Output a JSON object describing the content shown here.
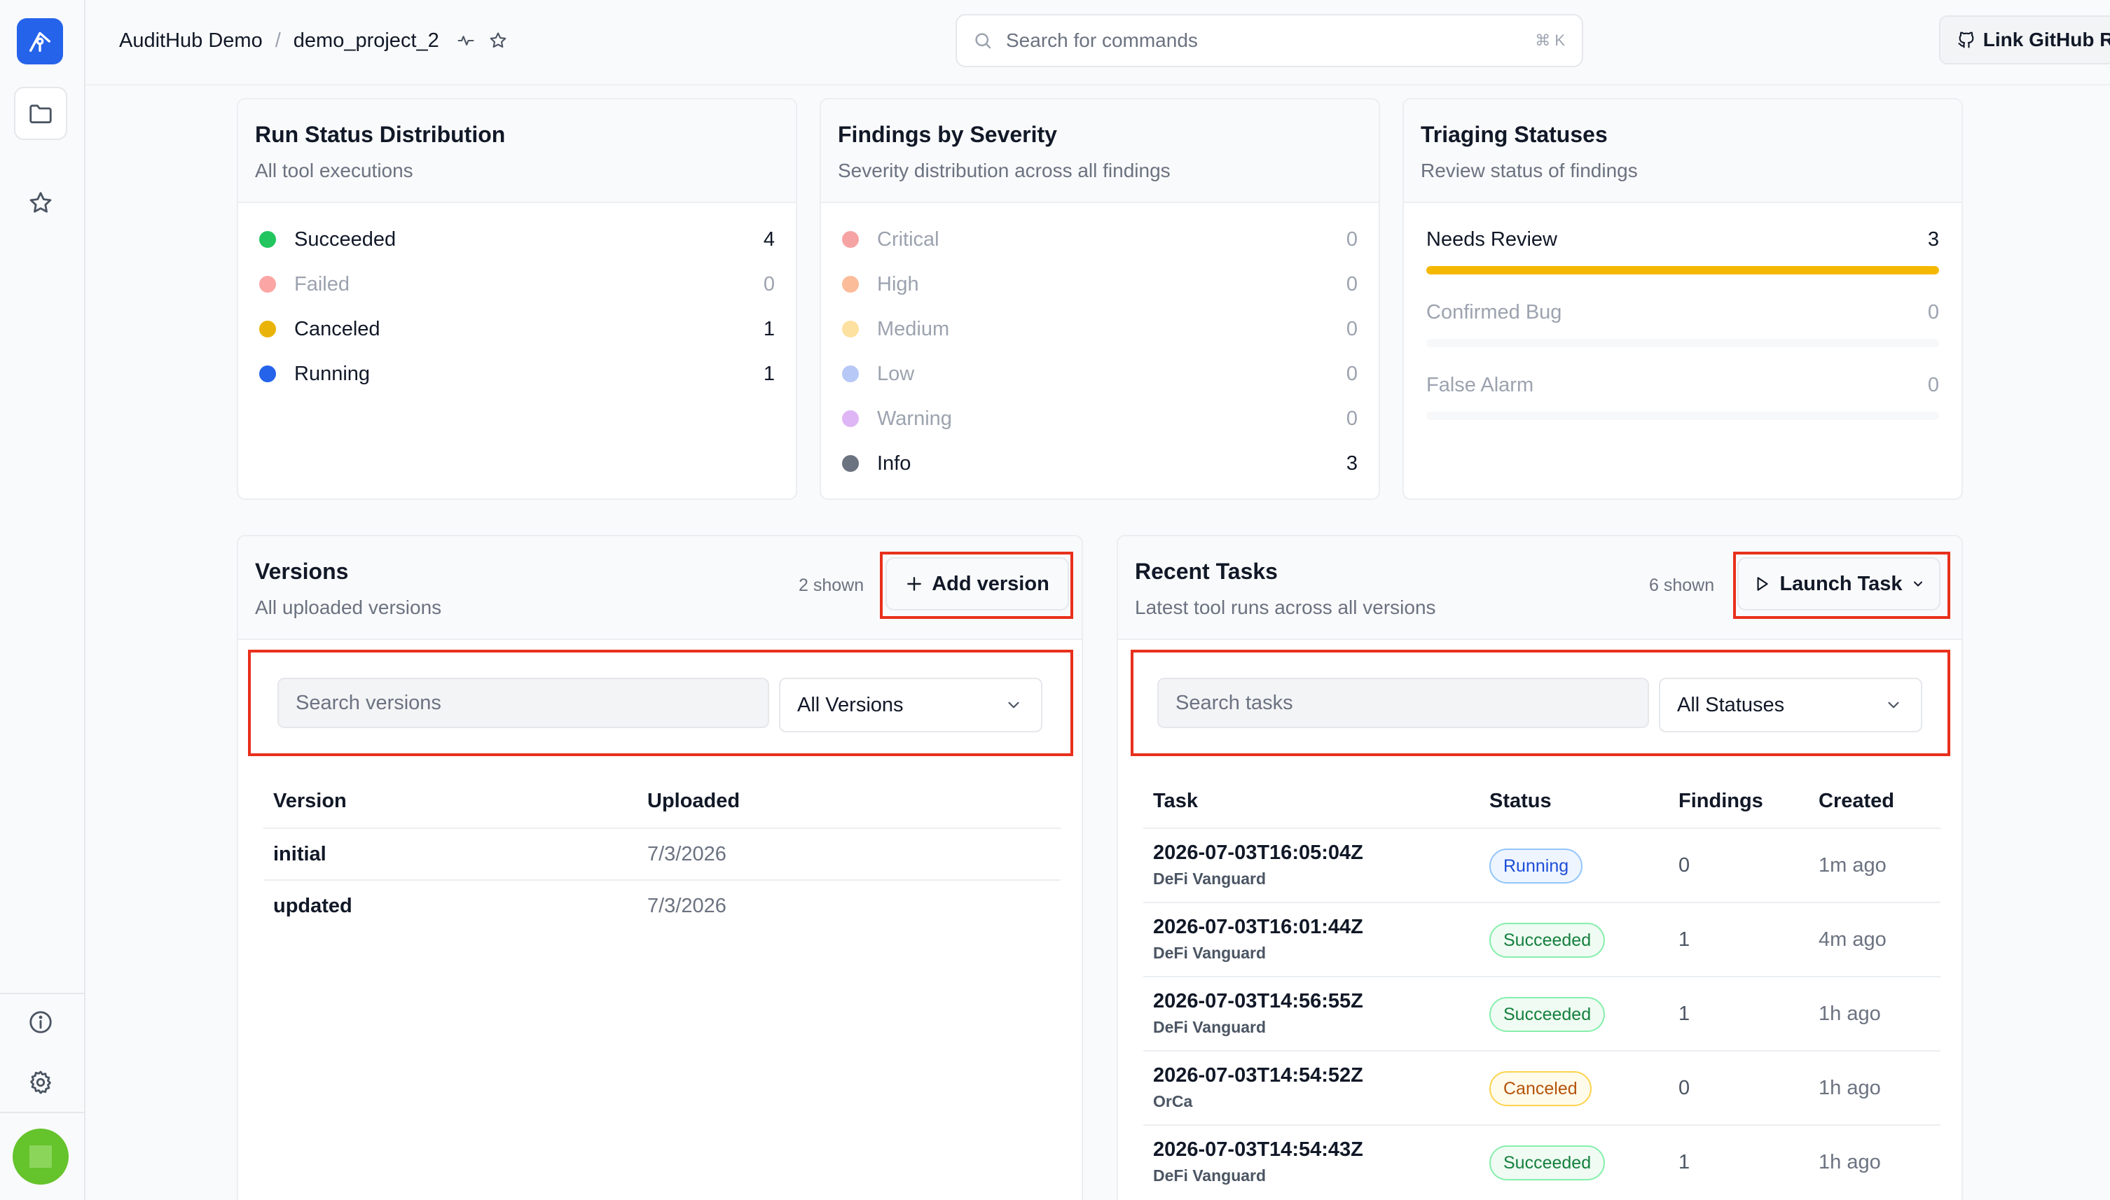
{
  "breadcrumb": {
    "org": "AuditHub Demo",
    "separator": "/",
    "project": "demo_project_2"
  },
  "search": {
    "placeholder": "Search for commands",
    "shortcut": "⌘ K"
  },
  "header": {
    "github_button": "Link GitHub Repo"
  },
  "sidebar": {
    "icons": [
      "logo-icon",
      "folder-icon",
      "star-icon",
      "info-icon",
      "gear-icon",
      "avatar"
    ]
  },
  "colors": {
    "succeeded": "#22c55e",
    "failed": "#fca5a5",
    "canceled": "#eab308",
    "running": "#2563eb",
    "critical": "#f6a3a3",
    "high": "#fbbc99",
    "medium": "#fde1a0",
    "low": "#b7c8f6",
    "warning": "#dfb6f5",
    "info": "#6b7280",
    "needs_review_bar": "#f5b800",
    "highlight_box": "#e8301c"
  },
  "run_status": {
    "title": "Run Status Distribution",
    "subtitle": "All tool executions",
    "items": [
      {
        "label": "Succeeded",
        "value": "4"
      },
      {
        "label": "Failed",
        "value": "0"
      },
      {
        "label": "Canceled",
        "value": "1"
      },
      {
        "label": "Running",
        "value": "1"
      }
    ]
  },
  "severity": {
    "title": "Findings by Severity",
    "subtitle": "Severity distribution across all findings",
    "items": [
      {
        "label": "Critical",
        "value": "0"
      },
      {
        "label": "High",
        "value": "0"
      },
      {
        "label": "Medium",
        "value": "0"
      },
      {
        "label": "Low",
        "value": "0"
      },
      {
        "label": "Warning",
        "value": "0"
      },
      {
        "label": "Info",
        "value": "3"
      }
    ]
  },
  "triaging": {
    "title": "Triaging Statuses",
    "subtitle": "Review status of findings",
    "items": [
      {
        "label": "Needs Review",
        "value": "3",
        "fraction": 1.0
      },
      {
        "label": "Confirmed Bug",
        "value": "0",
        "fraction": 0
      },
      {
        "label": "False Alarm",
        "value": "0",
        "fraction": 0
      }
    ]
  },
  "versions": {
    "title": "Versions",
    "subtitle": "All uploaded versions",
    "shown": "2 shown",
    "add_button": "Add version",
    "search_placeholder": "Search versions",
    "filter_value": "All Versions",
    "columns": [
      "Version",
      "Uploaded"
    ],
    "rows": [
      {
        "version": "initial",
        "uploaded": "7/3/2026"
      },
      {
        "version": "updated",
        "uploaded": "7/3/2026"
      }
    ]
  },
  "tasks": {
    "title": "Recent Tasks",
    "subtitle": "Latest tool runs across all versions",
    "shown": "6 shown",
    "launch_button": "Launch Task",
    "search_placeholder": "Search tasks",
    "filter_value": "All Statuses",
    "columns": [
      "Task",
      "Status",
      "Findings",
      "Created"
    ],
    "rows": [
      {
        "id": "2026-07-03T16:05:04Z",
        "tool": "DeFi Vanguard",
        "status": "Running",
        "findings": "0",
        "created": "1m ago"
      },
      {
        "id": "2026-07-03T16:01:44Z",
        "tool": "DeFi Vanguard",
        "status": "Succeeded",
        "findings": "1",
        "created": "4m ago"
      },
      {
        "id": "2026-07-03T14:56:55Z",
        "tool": "DeFi Vanguard",
        "status": "Succeeded",
        "findings": "1",
        "created": "1h ago"
      },
      {
        "id": "2026-07-03T14:54:52Z",
        "tool": "OrCa",
        "status": "Canceled",
        "findings": "0",
        "created": "1h ago"
      },
      {
        "id": "2026-07-03T14:54:43Z",
        "tool": "DeFi Vanguard",
        "status": "Succeeded",
        "findings": "1",
        "created": "1h ago"
      }
    ]
  }
}
